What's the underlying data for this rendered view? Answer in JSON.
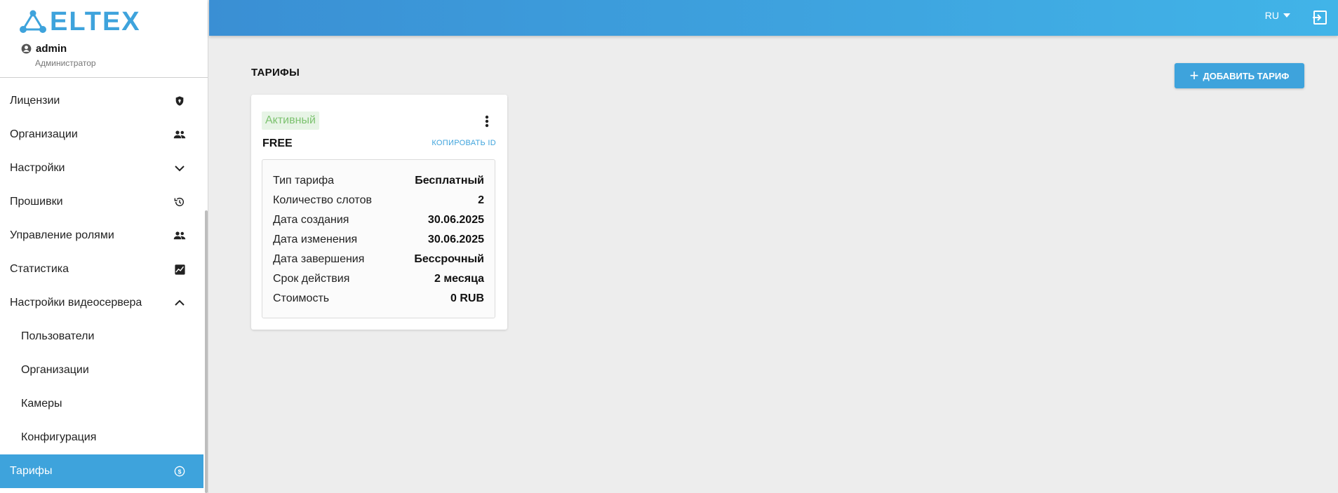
{
  "brand": {
    "logo_text": "ELTEX",
    "accent": "#3ea3dc"
  },
  "user": {
    "name": "admin",
    "role": "Администратор"
  },
  "sidebar": {
    "items": [
      {
        "label": "Лицензии",
        "icon": "shield-icon"
      },
      {
        "label": "Организации",
        "icon": "people-icon"
      },
      {
        "label": "Настройки",
        "icon": "chevron-down-icon"
      },
      {
        "label": "Прошивки",
        "icon": "history-icon"
      },
      {
        "label": "Управление ролями",
        "icon": "people-icon"
      },
      {
        "label": "Статистика",
        "icon": "chart-icon"
      },
      {
        "label": "Настройки видеосервера",
        "icon": "chevron-up-icon"
      },
      {
        "label": "Пользователи",
        "sub": true
      },
      {
        "label": "Организации",
        "sub": true
      },
      {
        "label": "Камеры",
        "sub": true
      },
      {
        "label": "Конфигурация",
        "sub": true
      },
      {
        "label": "Тарифы",
        "icon": "dollar-circle-icon",
        "active": true
      }
    ]
  },
  "header": {
    "language": "RU"
  },
  "page": {
    "title": "ТАРИФЫ",
    "add_button": "ДОБАВИТЬ ТАРИФ"
  },
  "tariff_card": {
    "status": "Активный",
    "name": "FREE",
    "copy_id": "КОПИРОВАТЬ ID",
    "details": [
      {
        "key": "Тип тарифа",
        "value": "Бесплатный"
      },
      {
        "key": "Количество слотов",
        "value": "2"
      },
      {
        "key": "Дата создания",
        "value": "30.06.2025"
      },
      {
        "key": "Дата изменения",
        "value": "30.06.2025"
      },
      {
        "key": "Дата завершения",
        "value": "Бессрочный"
      },
      {
        "key": "Срок действия",
        "value": "2 месяца"
      },
      {
        "key": "Стоимость",
        "value": "0 RUB"
      }
    ]
  }
}
